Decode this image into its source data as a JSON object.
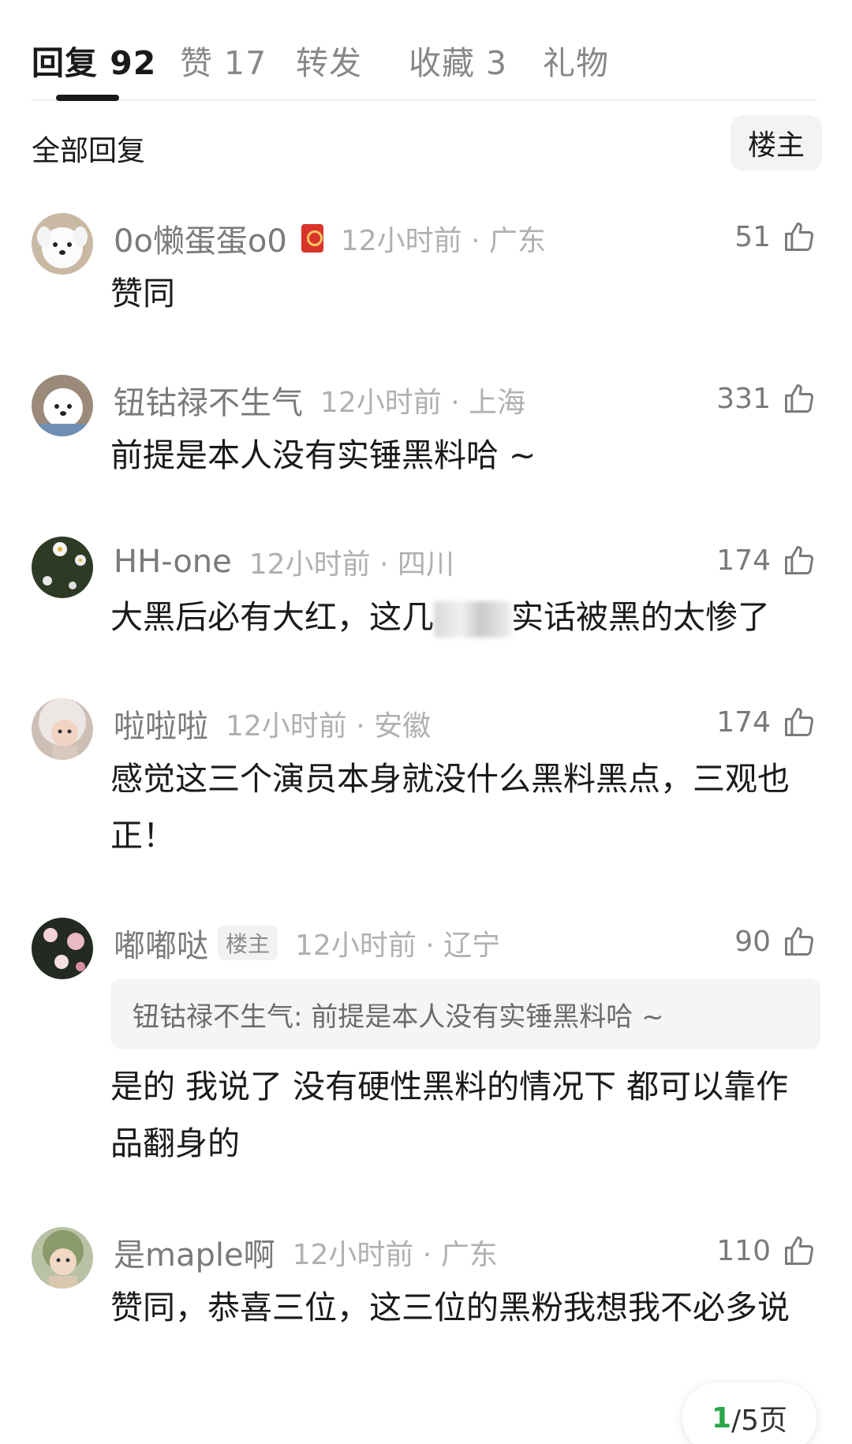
{
  "tabs": [
    {
      "label": "回复",
      "count": "92"
    },
    {
      "label": "赞",
      "count": "17"
    },
    {
      "label": "转发",
      "count": ""
    },
    {
      "label": "收藏",
      "count": "3"
    },
    {
      "label": "礼物",
      "count": ""
    }
  ],
  "filter": {
    "title": "全部回复",
    "owner_button": "楼主"
  },
  "comments": [
    {
      "username": "0o懒蛋蛋o0",
      "time": "12小时前",
      "location": "广东",
      "likes": "51",
      "text": "赞同",
      "medal_icon": "red-envelope-medal-icon"
    },
    {
      "username": "钮钴禄不生气",
      "time": "12小时前",
      "location": "上海",
      "likes": "331",
      "text": "前提是本人没有实锤黑料哈 ~"
    },
    {
      "username": "HH-one",
      "time": "12小时前",
      "location": "四川",
      "likes": "174",
      "text_before": "大黑后必有大红，这几",
      "text_after": "实话被黑的太惨了"
    },
    {
      "username": "啦啦啦",
      "time": "12小时前",
      "location": "安徽",
      "likes": "174",
      "text": "感觉这三个演员本身就没什么黑料黑点，三观也正！"
    },
    {
      "username": "嘟嘟哒",
      "badge": "楼主",
      "time": "12小时前",
      "location": "辽宁",
      "likes": "90",
      "quote": "钮钴禄不生气: 前提是本人没有实锤黑料哈 ~",
      "text": "是的 我说了 没有硬性黑料的情况下 都可以靠作品翻身的"
    },
    {
      "username": "是maple啊",
      "time": "12小时前",
      "location": "广东",
      "likes": "110",
      "text": "赞同，恭喜三位，这三位的黑粉我想我不必多说"
    }
  ],
  "pager": {
    "current": "1",
    "total_label": "/5页"
  },
  "colors": {
    "accent_green": "#2aa54b",
    "muted_text": "#7a7a7a",
    "light_text": "#b0b0b0"
  }
}
